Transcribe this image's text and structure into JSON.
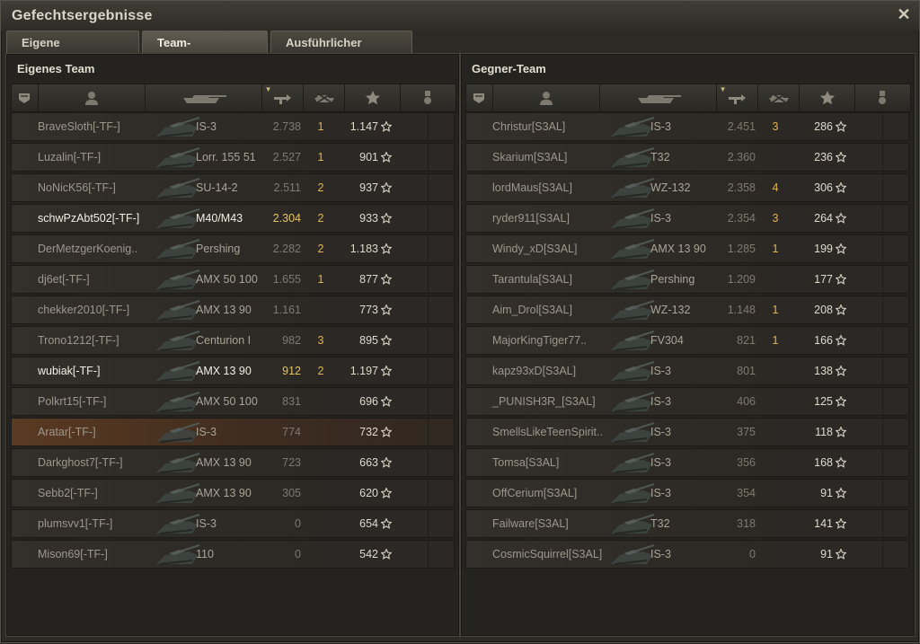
{
  "window": {
    "title": "Gefechtsergebnisse",
    "close_glyph": "✕"
  },
  "tabs": [
    {
      "label": "Eigene Auswertung",
      "active": false
    },
    {
      "label": "Team-Auswertung",
      "active": true
    },
    {
      "label": "Ausführlicher Bericht",
      "active": false
    }
  ],
  "colors": {
    "accent_gold": "#e0b454",
    "self_row": "#5a3a22"
  },
  "teams": [
    {
      "title": "Eigenes Team",
      "rows": [
        {
          "name": "BraveSloth[-TF-]",
          "tank": "IS-3",
          "dmg": "2.738",
          "kills": "1",
          "xp": "1.147",
          "highlight": false,
          "self": false
        },
        {
          "name": "Luzalin[-TF-]",
          "tank": "Lorr. 155 51",
          "dmg": "2.527",
          "kills": "1",
          "xp": "901",
          "highlight": false,
          "self": false
        },
        {
          "name": "NoNicK56[-TF-]",
          "tank": "SU-14-2",
          "dmg": "2.511",
          "kills": "2",
          "xp": "937",
          "highlight": false,
          "self": false
        },
        {
          "name": "schwPzAbt502[-TF-]",
          "tank": "M40/M43",
          "dmg": "2.304",
          "kills": "2",
          "xp": "933",
          "highlight": true,
          "self": false
        },
        {
          "name": "DerMetzgerKoenig..",
          "tank": "Pershing",
          "dmg": "2.282",
          "kills": "2",
          "xp": "1.183",
          "highlight": false,
          "self": false
        },
        {
          "name": "dj6et[-TF-]",
          "tank": "AMX 50 100",
          "dmg": "1.655",
          "kills": "1",
          "xp": "877",
          "highlight": false,
          "self": false
        },
        {
          "name": "chekker2010[-TF-]",
          "tank": "AMX 13 90",
          "dmg": "1.161",
          "kills": "",
          "xp": "773",
          "highlight": false,
          "self": false
        },
        {
          "name": "Trono1212[-TF-]",
          "tank": "Centurion I",
          "dmg": "982",
          "kills": "3",
          "xp": "895",
          "highlight": false,
          "self": false
        },
        {
          "name": "wubiak[-TF-]",
          "tank": "AMX 13 90",
          "dmg": "912",
          "kills": "2",
          "xp": "1.197",
          "highlight": true,
          "self": false
        },
        {
          "name": "Polkrt15[-TF-]",
          "tank": "AMX 50 100",
          "dmg": "831",
          "kills": "",
          "xp": "696",
          "highlight": false,
          "self": false
        },
        {
          "name": "Aratar[-TF-]",
          "tank": "IS-3",
          "dmg": "774",
          "kills": "",
          "xp": "732",
          "highlight": false,
          "self": true
        },
        {
          "name": "Darkghost7[-TF-]",
          "tank": "AMX 13 90",
          "dmg": "723",
          "kills": "",
          "xp": "663",
          "highlight": false,
          "self": false
        },
        {
          "name": "Sebb2[-TF-]",
          "tank": "AMX 13 90",
          "dmg": "305",
          "kills": "",
          "xp": "620",
          "highlight": false,
          "self": false
        },
        {
          "name": "plumsvv1[-TF-]",
          "tank": "IS-3",
          "dmg": "0",
          "kills": "",
          "xp": "654",
          "highlight": false,
          "self": false
        },
        {
          "name": "Mison69[-TF-]",
          "tank": "110",
          "dmg": "0",
          "kills": "",
          "xp": "542",
          "highlight": false,
          "self": false
        }
      ]
    },
    {
      "title": "Gegner-Team",
      "rows": [
        {
          "name": "Christur[S3AL]",
          "tank": "IS-3",
          "dmg": "2.451",
          "kills": "3",
          "xp": "286",
          "highlight": false,
          "self": false
        },
        {
          "name": "Skarium[S3AL]",
          "tank": "T32",
          "dmg": "2.360",
          "kills": "",
          "xp": "236",
          "highlight": false,
          "self": false
        },
        {
          "name": "lordMaus[S3AL]",
          "tank": "WZ-132",
          "dmg": "2.358",
          "kills": "4",
          "xp": "306",
          "highlight": false,
          "self": false
        },
        {
          "name": "ryder911[S3AL]",
          "tank": "IS-3",
          "dmg": "2.354",
          "kills": "3",
          "xp": "264",
          "highlight": false,
          "self": false
        },
        {
          "name": "Windy_xD[S3AL]",
          "tank": "AMX 13 90",
          "dmg": "1.285",
          "kills": "1",
          "xp": "199",
          "highlight": false,
          "self": false
        },
        {
          "name": "Tarantula[S3AL]",
          "tank": "Pershing",
          "dmg": "1.209",
          "kills": "",
          "xp": "177",
          "highlight": false,
          "self": false
        },
        {
          "name": "Aim_Drol[S3AL]",
          "tank": "WZ-132",
          "dmg": "1.148",
          "kills": "1",
          "xp": "208",
          "highlight": false,
          "self": false
        },
        {
          "name": "MajorKingTiger77..",
          "tank": "FV304",
          "dmg": "821",
          "kills": "1",
          "xp": "166",
          "highlight": false,
          "self": false
        },
        {
          "name": "kapz93xD[S3AL]",
          "tank": "IS-3",
          "dmg": "801",
          "kills": "",
          "xp": "138",
          "highlight": false,
          "self": false
        },
        {
          "name": "_PUNISH3R_[S3AL]",
          "tank": "IS-3",
          "dmg": "406",
          "kills": "",
          "xp": "125",
          "highlight": false,
          "self": false
        },
        {
          "name": "SmellsLikeTeenSpirit..",
          "tank": "IS-3",
          "dmg": "375",
          "kills": "",
          "xp": "118",
          "highlight": false,
          "self": false
        },
        {
          "name": "Tomsa[S3AL]",
          "tank": "IS-3",
          "dmg": "356",
          "kills": "",
          "xp": "168",
          "highlight": false,
          "self": false
        },
        {
          "name": "OffCerium[S3AL]",
          "tank": "IS-3",
          "dmg": "354",
          "kills": "",
          "xp": "91",
          "highlight": false,
          "self": false
        },
        {
          "name": "Failware[S3AL]",
          "tank": "T32",
          "dmg": "318",
          "kills": "",
          "xp": "141",
          "highlight": false,
          "self": false
        },
        {
          "name": "CosmicSquirrel[S3AL]",
          "tank": "IS-3",
          "dmg": "0",
          "kills": "",
          "xp": "91",
          "highlight": false,
          "self": false
        }
      ]
    }
  ]
}
